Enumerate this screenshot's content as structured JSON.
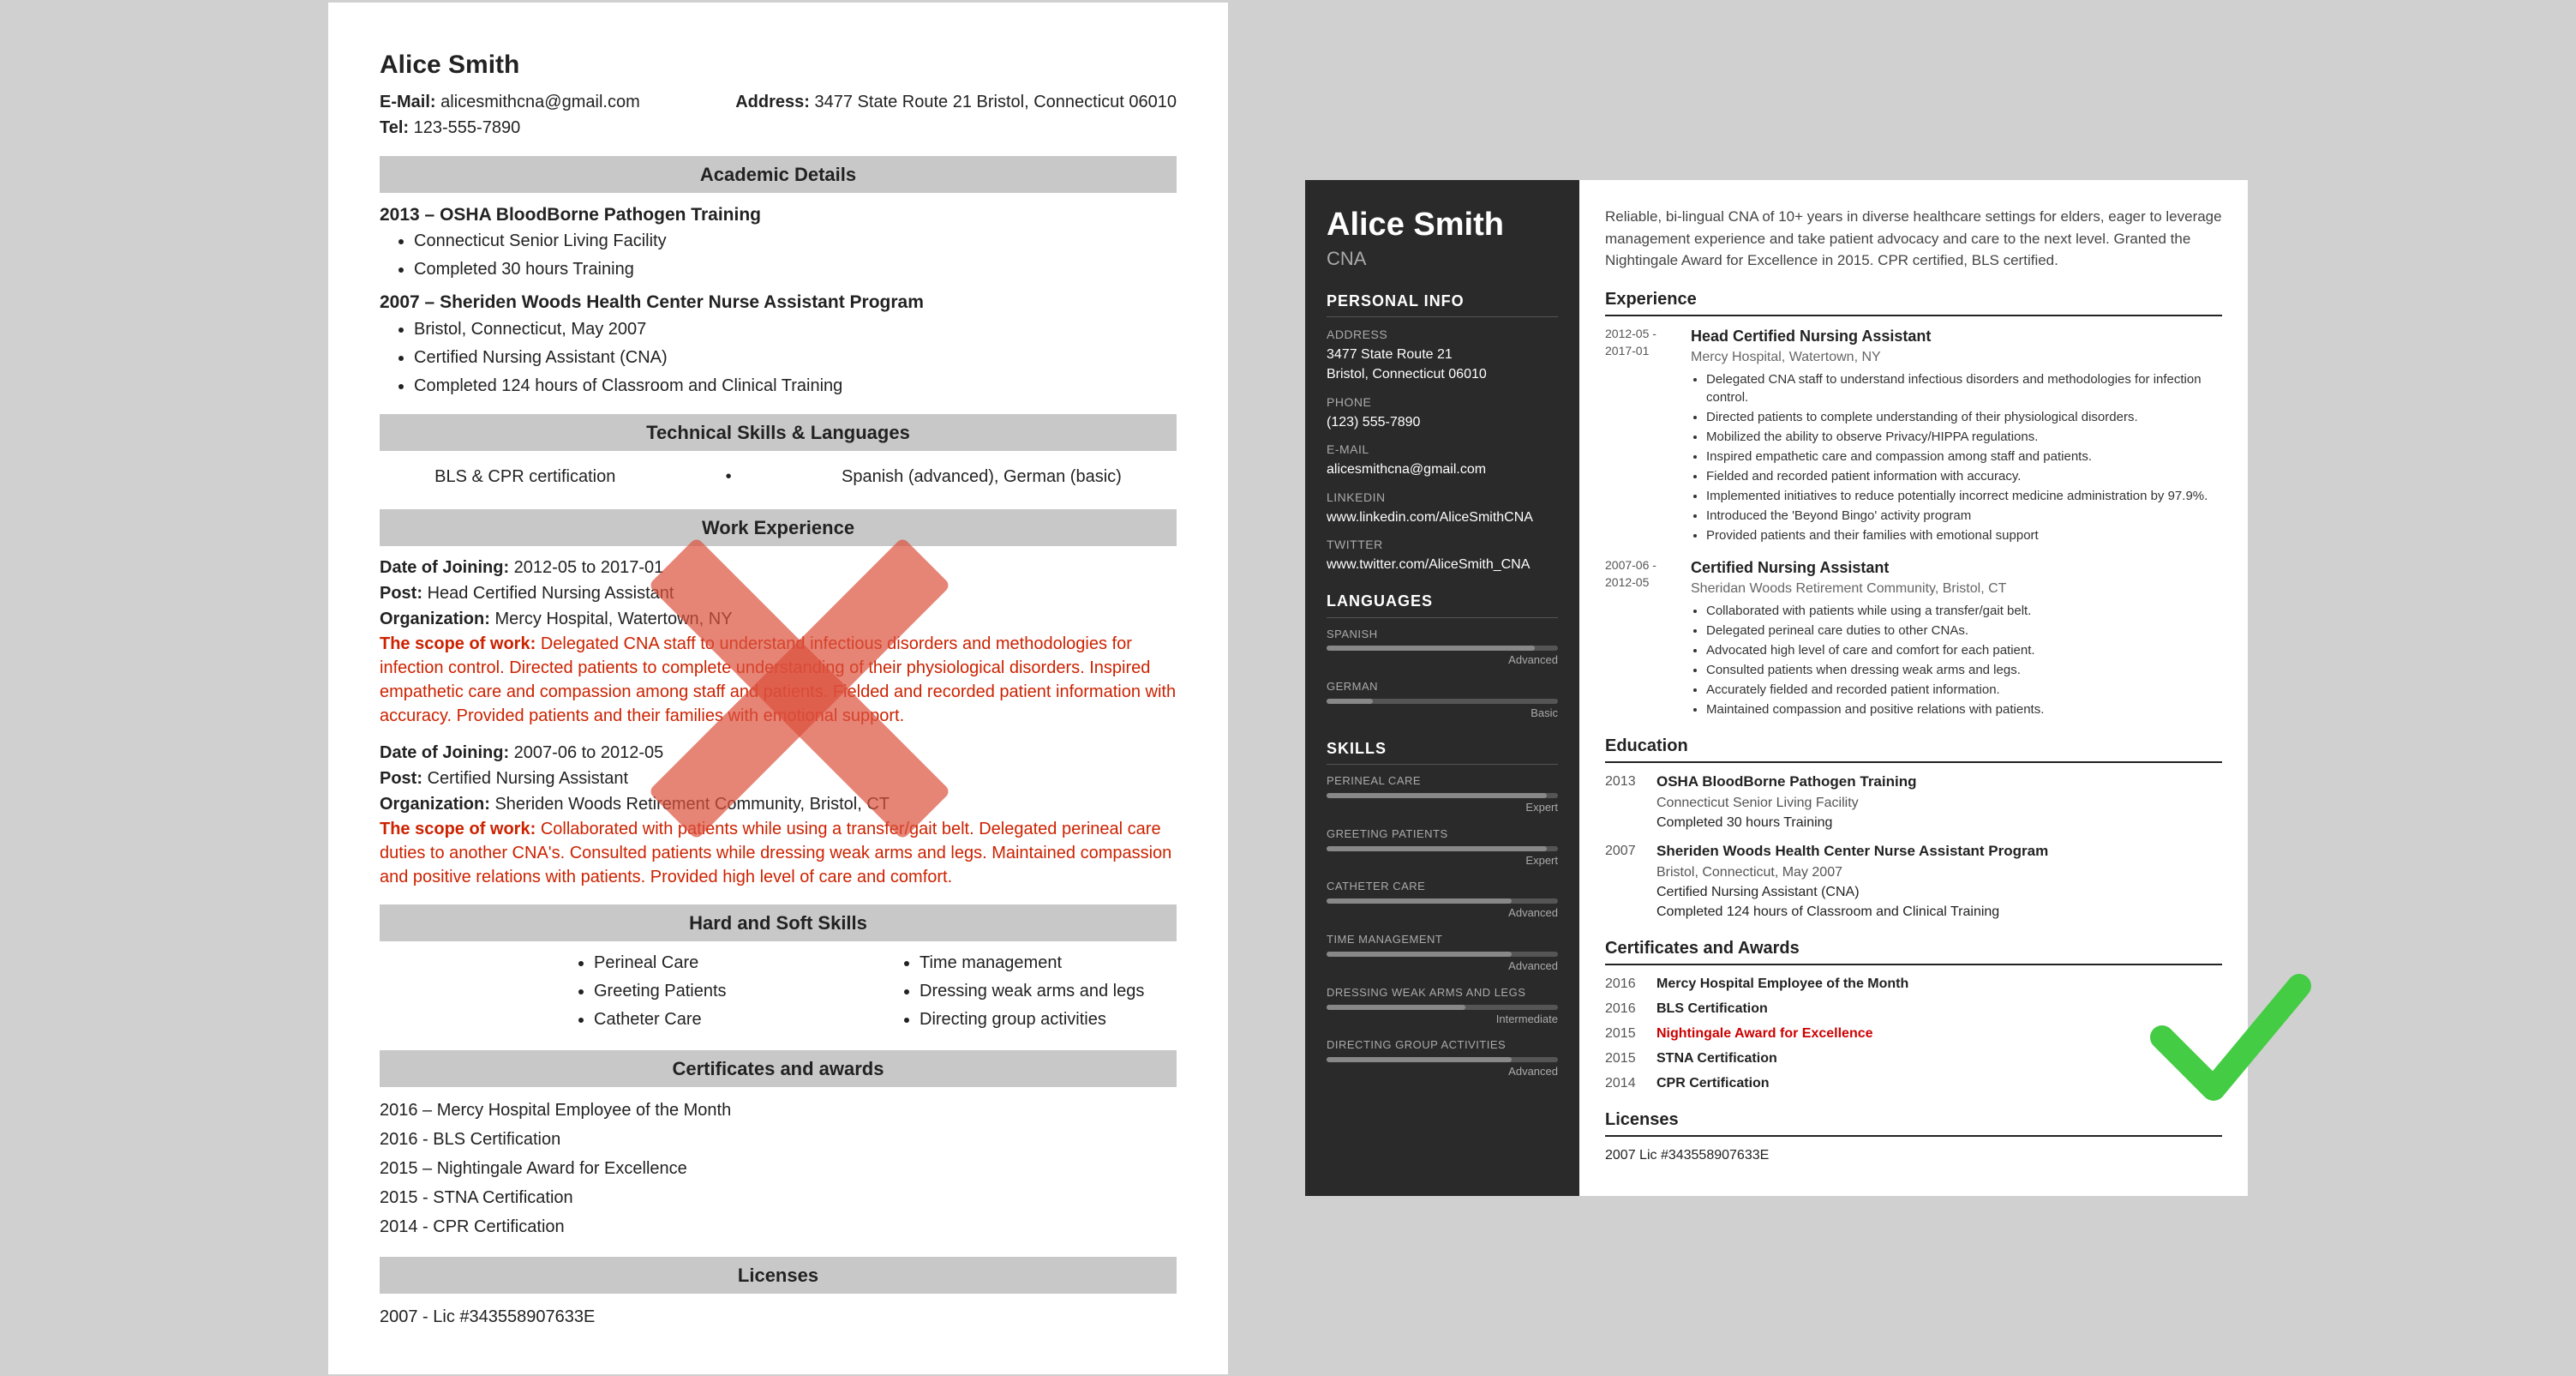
{
  "left_resume": {
    "name": "Alice Smith",
    "email_label": "E-Mail:",
    "email": "alicesmithcna@gmail.com",
    "address_label": "Address:",
    "address": "3477 State Route 21 Bristol, Connecticut 06010",
    "tel_label": "Tel:",
    "tel": "123-555-7890",
    "sections": {
      "academic": {
        "title": "Academic Details",
        "items": [
          {
            "year": "2013 –",
            "title": "OSHA BloodBorne Pathogen Training",
            "bullets": [
              "Connecticut Senior Living Facility",
              "Completed 30 hours Training"
            ]
          },
          {
            "year": "2007 –",
            "title": "Sheriden Woods Health Center Nurse Assistant Program",
            "bullets": [
              "Bristol, Connecticut, May 2007",
              "Certified Nursing Assistant (CNA)",
              "Completed 124 hours of Classroom and Clinical Training"
            ]
          }
        ]
      },
      "technical": {
        "title": "Technical Skills & Languages",
        "skills": "BLS & CPR certification",
        "languages": "Spanish (advanced), German (basic)"
      },
      "work": {
        "title": "Work Experience",
        "items": [
          {
            "date": "Date of Joining:",
            "date_val": "2012-05 to 2017-01",
            "post": "Post:",
            "post_val": "Head Certified Nursing Assistant",
            "org": "Organization:",
            "org_val": "Mercy Hospital, Watertown, NY",
            "scope": "The scope of work:",
            "scope_val": "Delegated CNA staff to understand infectious disorders and methodologies for infection control. Directed patients to complete understanding of their physiological disorders. Inspired empathetic care and compassion among staff and patients. Fielded and recorded patient information with accuracy. Provided patients and their families with emotional support."
          },
          {
            "date": "Date of Joining:",
            "date_val": "2007-06 to 2012-05",
            "post": "Post:",
            "post_val": "Certified Nursing Assistant",
            "org": "Organization:",
            "org_val": "Sheriden Woods Retirement Community, Bristol, CT",
            "scope": "The scope of work:",
            "scope_val": "Collaborated with patients while using a transfer/gait belt. Delegated perineal care duties to another CNA's. Consulted patients while dressing weak arms and legs. Maintained compassion and positive relations with patients. Provided high level of care and comfort."
          }
        ]
      },
      "hard_soft": {
        "title": "Hard and Soft Skills",
        "items": [
          "Perineal Care",
          "Greeting Patients",
          "Catheter Care",
          "Time management",
          "Dressing weak arms and legs",
          "Directing group activities"
        ]
      },
      "certs": {
        "title": "Certificates and awards",
        "items": [
          "2016 – Mercy Hospital Employee of the Month",
          "2016 - BLS Certification",
          "2015 – Nightingale Award for Excellence",
          "2015 - STNA Certification",
          "2014 - CPR Certification"
        ]
      },
      "licenses": {
        "title": "Licenses",
        "items": [
          "2007 - Lic #343558907633E"
        ]
      }
    }
  },
  "right_resume": {
    "name": "Alice Smith",
    "title": "CNA",
    "summary": "Reliable, bi-lingual CNA of 10+ years in diverse healthcare settings for elders, eager to leverage management experience and take patient advocacy and care to the next level. Granted the Nightingale Award for Excellence in 2015. CPR certified, BLS certified.",
    "sidebar": {
      "personal_info_title": "Personal Info",
      "address_label": "Address",
      "address_val": "3477 State Route 21\nBristol, Connecticut 06010",
      "phone_label": "Phone",
      "phone_val": "(123) 555-7890",
      "email_label": "E-mail",
      "email_val": "alicesmithcna@gmail.com",
      "linkedin_label": "Linkedin",
      "linkedin_val": "www.linkedin.com/AliceSmithCNA",
      "twitter_label": "Twitter",
      "twitter_val": "www.twitter.com/AliceSmith_CNA",
      "languages_title": "Languages",
      "languages": [
        {
          "name": "SPANISH",
          "level": "Advanced",
          "pct": 90
        },
        {
          "name": "GERMAN",
          "level": "Basic",
          "pct": 20
        }
      ],
      "skills_title": "Skills",
      "skills": [
        {
          "name": "PERINEAL CARE",
          "level": "Expert",
          "pct": 95
        },
        {
          "name": "GREETING PATIENTS",
          "level": "Expert",
          "pct": 95
        },
        {
          "name": "CATHETER CARE",
          "level": "Advanced",
          "pct": 80
        },
        {
          "name": "TIME MANAGEMENT",
          "level": "Advanced",
          "pct": 80
        },
        {
          "name": "DRESSING WEAK ARMS AND LEGS",
          "level": "Intermediate",
          "pct": 60
        },
        {
          "name": "DIRECTING GROUP ACTIVITIES",
          "level": "Advanced",
          "pct": 80
        }
      ]
    },
    "experience_title": "Experience",
    "experience": [
      {
        "dates": "2012-05 -\n2017-01",
        "title": "Head Certified Nursing Assistant",
        "org": "Mercy Hospital, Watertown, NY",
        "bullets": [
          "Delegated CNA staff to understand infectious disorders and methodologies for infection control.",
          "Directed patients to complete understanding of their physiological disorders.",
          "Mobilized the ability to observe Privacy/HIPPA regulations.",
          "Inspired empathetic care and compassion among staff and patients.",
          "Fielded and recorded patient information with accuracy.",
          "Implemented initiatives to reduce potentially incorrect medicine administration by 97.9%.",
          "Introduced the 'Beyond Bingo' activity program",
          "Provided patients and their families with emotional support"
        ]
      },
      {
        "dates": "2007-06 -\n2012-05",
        "title": "Certified Nursing Assistant",
        "org": "Sheridan Woods Retirement Community, Bristol, CT",
        "bullets": [
          "Collaborated with patients while using a transfer/gait belt.",
          "Delegated perineal care duties to other CNAs.",
          "Advocated high level of care and comfort for each patient.",
          "Consulted patients when dressing weak arms and legs.",
          "Accurately fielded and recorded patient information.",
          "Maintained compassion and positive relations with patients."
        ]
      }
    ],
    "education_title": "Education",
    "education": [
      {
        "year": "2013",
        "title": "OSHA BloodBorne Pathogen Training",
        "org": "Connecticut Senior Living Facility",
        "detail": "Completed 30 hours Training"
      },
      {
        "year": "2007",
        "title": "Sheriden Woods Health Center Nurse Assistant Program",
        "org": "Bristol, Connecticut, May 2007",
        "detail1": "Certified Nursing Assistant (CNA)",
        "detail2": "Completed 124 hours of Classroom and Clinical Training"
      }
    ],
    "certs_title": "Certificates and Awards",
    "certs": [
      {
        "year": "2016",
        "name": "Mercy Hospital Employee of the Month",
        "highlight": false
      },
      {
        "year": "2016",
        "name": "BLS Certification",
        "highlight": false
      },
      {
        "year": "2015",
        "name": "Nightingale Award for Excellence",
        "highlight": true
      },
      {
        "year": "2015",
        "name": "STNA Certification",
        "highlight": false
      },
      {
        "year": "2014",
        "name": "CPR Certification",
        "highlight": false
      }
    ],
    "licenses_title": "Licenses",
    "licenses": [
      "2007    Lic #343558907633E"
    ]
  }
}
